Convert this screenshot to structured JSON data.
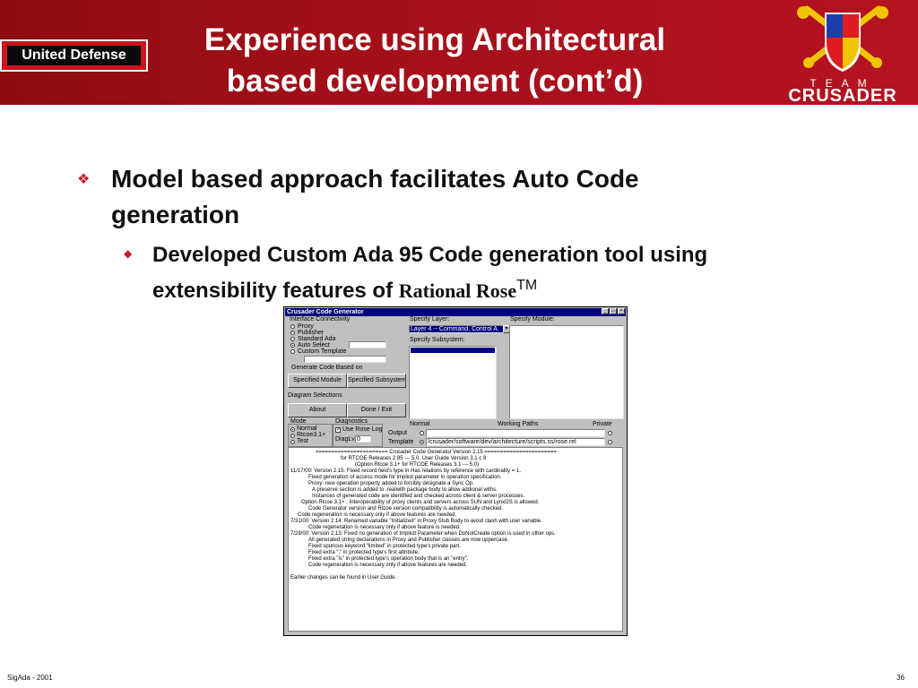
{
  "header": {
    "brand": "United Defense",
    "title_line1": "Experience using Architectural",
    "title_line2": "based development (cont’d)",
    "logo": {
      "team": "TEAM",
      "name": "CRUSADER",
      "icon": "team-crusader-crest"
    },
    "colors": {
      "header_bg": "#a3101a",
      "bullet": "#c01d2a"
    }
  },
  "bullets": {
    "b1_mark": "❖",
    "b1_line1": "Model based approach facilitates Auto Code",
    "b1_line2": "generation",
    "b2_mark": "◆",
    "b2_line1": "Developed Custom Ada 95 Code generation tool using",
    "b2_line2": "extensibility features of ",
    "b2_rose": "Rational Rose",
    "b2_tm": "TM"
  },
  "app": {
    "title": "Crusader Code Generator",
    "interface": {
      "label": "Interface Connectivity",
      "options": [
        "Proxy",
        "Publisher",
        "Standard Ada",
        "Auto Select",
        "Custom Template"
      ],
      "selected": "Auto Select"
    },
    "generate_label": "Generate Code Based on",
    "btn_specified_module": "Specified Module",
    "btn_specified_subsystem": "Specified Subsystem",
    "diagram_label": "Diagram Selections",
    "btn_about": "About",
    "btn_done": "Done / Exit",
    "specify_layer_label": "Specify Layer:",
    "layer_value": "Layer 4 -- Command, Control A",
    "specify_subsystem_label": "Specify Subsystem:",
    "specify_module_label": "Specify Module:",
    "mode": {
      "label": "Mode",
      "options": [
        "Normal",
        "Rtcoe3.1+",
        "Test"
      ],
      "selected": "Normal"
    },
    "diagnostics": {
      "label": "Diagnostics",
      "use_rose_log": "Use Rose Log",
      "diag_lvl": "DiagLvl",
      "diag_value": "0"
    },
    "paths": {
      "normal": "Normal",
      "working_paths": "Working Paths",
      "private": "Private",
      "output_label": "Output",
      "template_label": "Template",
      "template_value": "/crusader/software/dev/architecture/scripts.ss/rose.rel"
    },
    "log": [
      "======================= Crusader Code Generator Version 2.15 =======================",
      "for RTCOE Releases 2.85 --- 5.0, User Guide Version 3.1 c 8",
      "(Option Rtcoe 3.1+ for RTCOE Releases 3.1 --- 5.0)",
      "11/17/00: Version 2.15: Fixed record field's type in Has relations by reference with cardinality = 1.",
      "Fixed generation of access mode for implicit parameter in operation specification.",
      "Proxy: new operation property added to forcibly designate a Sync Op.",
      "A preserve section is added to .realwith package body to allow addional withs.",
      "Instances of generated code are identified and checked across client & server processes.",
      "Option Rtcoe 3.1+ : Interoperability of proxy clients and servers across SUN and LynxOS is allowed.",
      "Code Generator version and Rtcoe version compatibility is automatically checked.",
      "Code regeneration is necessary only if above features are needed.",
      "7/31/00: Version 2.14: Renamed variable \"Initialized\" in Proxy Stub Body to avoid clash with user variable.",
      "Code regeneration is necessary only if above feature is needed.",
      "7/28/00: Version 2.13: Fixed no generation of Implicit Parameter when DoNotCreate option is used in other ops.",
      "All generated string declarations in Proxy and Publisher classes are now uppercase.",
      "Fixed spurious keyword \"limited\" in protected type's private part.",
      "Fixed extra \";\" in protected type's first attribute.",
      "Fixed extra \"is\" in protected type's operation body that is an \"entry\".",
      "Code regeneration is necessary only if above features are needed.",
      "",
      "Earlier changes can be found in User Guide."
    ]
  },
  "footer": {
    "left": "SigAda - 2001",
    "page": "36"
  }
}
